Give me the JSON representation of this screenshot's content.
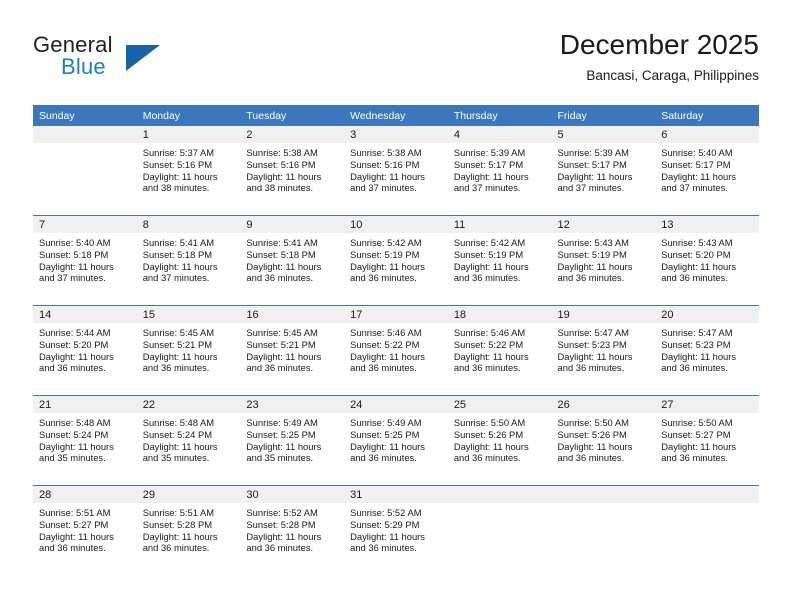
{
  "logo": {
    "word1": "General",
    "word2": "Blue",
    "triangle_color": "#1763a8",
    "blue_color": "#1c7fc3"
  },
  "header": {
    "title": "December 2025",
    "subtitle": "Bancasi, Caraga, Philippines"
  },
  "theme": {
    "header_blue": "#3b77bd",
    "band_gray": "#f0f0f0",
    "text": "#1a1a1a"
  },
  "calendar": {
    "weekday_headers": [
      "Sunday",
      "Monday",
      "Tuesday",
      "Wednesday",
      "Thursday",
      "Friday",
      "Saturday"
    ],
    "weeks": [
      [
        {
          "day": "",
          "empty": true,
          "sunrise": "",
          "sunset": "",
          "daylight1": "",
          "daylight2": ""
        },
        {
          "day": "1",
          "sunrise": "Sunrise: 5:37 AM",
          "sunset": "Sunset: 5:16 PM",
          "daylight1": "Daylight: 11 hours",
          "daylight2": "and 38 minutes."
        },
        {
          "day": "2",
          "sunrise": "Sunrise: 5:38 AM",
          "sunset": "Sunset: 5:16 PM",
          "daylight1": "Daylight: 11 hours",
          "daylight2": "and 38 minutes."
        },
        {
          "day": "3",
          "sunrise": "Sunrise: 5:38 AM",
          "sunset": "Sunset: 5:16 PM",
          "daylight1": "Daylight: 11 hours",
          "daylight2": "and 37 minutes."
        },
        {
          "day": "4",
          "sunrise": "Sunrise: 5:39 AM",
          "sunset": "Sunset: 5:17 PM",
          "daylight1": "Daylight: 11 hours",
          "daylight2": "and 37 minutes."
        },
        {
          "day": "5",
          "sunrise": "Sunrise: 5:39 AM",
          "sunset": "Sunset: 5:17 PM",
          "daylight1": "Daylight: 11 hours",
          "daylight2": "and 37 minutes."
        },
        {
          "day": "6",
          "sunrise": "Sunrise: 5:40 AM",
          "sunset": "Sunset: 5:17 PM",
          "daylight1": "Daylight: 11 hours",
          "daylight2": "and 37 minutes."
        }
      ],
      [
        {
          "day": "7",
          "sunrise": "Sunrise: 5:40 AM",
          "sunset": "Sunset: 5:18 PM",
          "daylight1": "Daylight: 11 hours",
          "daylight2": "and 37 minutes."
        },
        {
          "day": "8",
          "sunrise": "Sunrise: 5:41 AM",
          "sunset": "Sunset: 5:18 PM",
          "daylight1": "Daylight: 11 hours",
          "daylight2": "and 37 minutes."
        },
        {
          "day": "9",
          "sunrise": "Sunrise: 5:41 AM",
          "sunset": "Sunset: 5:18 PM",
          "daylight1": "Daylight: 11 hours",
          "daylight2": "and 36 minutes."
        },
        {
          "day": "10",
          "sunrise": "Sunrise: 5:42 AM",
          "sunset": "Sunset: 5:19 PM",
          "daylight1": "Daylight: 11 hours",
          "daylight2": "and 36 minutes."
        },
        {
          "day": "11",
          "sunrise": "Sunrise: 5:42 AM",
          "sunset": "Sunset: 5:19 PM",
          "daylight1": "Daylight: 11 hours",
          "daylight2": "and 36 minutes."
        },
        {
          "day": "12",
          "sunrise": "Sunrise: 5:43 AM",
          "sunset": "Sunset: 5:19 PM",
          "daylight1": "Daylight: 11 hours",
          "daylight2": "and 36 minutes."
        },
        {
          "day": "13",
          "sunrise": "Sunrise: 5:43 AM",
          "sunset": "Sunset: 5:20 PM",
          "daylight1": "Daylight: 11 hours",
          "daylight2": "and 36 minutes."
        }
      ],
      [
        {
          "day": "14",
          "sunrise": "Sunrise: 5:44 AM",
          "sunset": "Sunset: 5:20 PM",
          "daylight1": "Daylight: 11 hours",
          "daylight2": "and 36 minutes."
        },
        {
          "day": "15",
          "sunrise": "Sunrise: 5:45 AM",
          "sunset": "Sunset: 5:21 PM",
          "daylight1": "Daylight: 11 hours",
          "daylight2": "and 36 minutes."
        },
        {
          "day": "16",
          "sunrise": "Sunrise: 5:45 AM",
          "sunset": "Sunset: 5:21 PM",
          "daylight1": "Daylight: 11 hours",
          "daylight2": "and 36 minutes."
        },
        {
          "day": "17",
          "sunrise": "Sunrise: 5:46 AM",
          "sunset": "Sunset: 5:22 PM",
          "daylight1": "Daylight: 11 hours",
          "daylight2": "and 36 minutes."
        },
        {
          "day": "18",
          "sunrise": "Sunrise: 5:46 AM",
          "sunset": "Sunset: 5:22 PM",
          "daylight1": "Daylight: 11 hours",
          "daylight2": "and 36 minutes."
        },
        {
          "day": "19",
          "sunrise": "Sunrise: 5:47 AM",
          "sunset": "Sunset: 5:23 PM",
          "daylight1": "Daylight: 11 hours",
          "daylight2": "and 36 minutes."
        },
        {
          "day": "20",
          "sunrise": "Sunrise: 5:47 AM",
          "sunset": "Sunset: 5:23 PM",
          "daylight1": "Daylight: 11 hours",
          "daylight2": "and 36 minutes."
        }
      ],
      [
        {
          "day": "21",
          "sunrise": "Sunrise: 5:48 AM",
          "sunset": "Sunset: 5:24 PM",
          "daylight1": "Daylight: 11 hours",
          "daylight2": "and 35 minutes."
        },
        {
          "day": "22",
          "sunrise": "Sunrise: 5:48 AM",
          "sunset": "Sunset: 5:24 PM",
          "daylight1": "Daylight: 11 hours",
          "daylight2": "and 35 minutes."
        },
        {
          "day": "23",
          "sunrise": "Sunrise: 5:49 AM",
          "sunset": "Sunset: 5:25 PM",
          "daylight1": "Daylight: 11 hours",
          "daylight2": "and 35 minutes."
        },
        {
          "day": "24",
          "sunrise": "Sunrise: 5:49 AM",
          "sunset": "Sunset: 5:25 PM",
          "daylight1": "Daylight: 11 hours",
          "daylight2": "and 36 minutes."
        },
        {
          "day": "25",
          "sunrise": "Sunrise: 5:50 AM",
          "sunset": "Sunset: 5:26 PM",
          "daylight1": "Daylight: 11 hours",
          "daylight2": "and 36 minutes."
        },
        {
          "day": "26",
          "sunrise": "Sunrise: 5:50 AM",
          "sunset": "Sunset: 5:26 PM",
          "daylight1": "Daylight: 11 hours",
          "daylight2": "and 36 minutes."
        },
        {
          "day": "27",
          "sunrise": "Sunrise: 5:50 AM",
          "sunset": "Sunset: 5:27 PM",
          "daylight1": "Daylight: 11 hours",
          "daylight2": "and 36 minutes."
        }
      ],
      [
        {
          "day": "28",
          "sunrise": "Sunrise: 5:51 AM",
          "sunset": "Sunset: 5:27 PM",
          "daylight1": "Daylight: 11 hours",
          "daylight2": "and 36 minutes."
        },
        {
          "day": "29",
          "sunrise": "Sunrise: 5:51 AM",
          "sunset": "Sunset: 5:28 PM",
          "daylight1": "Daylight: 11 hours",
          "daylight2": "and 36 minutes."
        },
        {
          "day": "30",
          "sunrise": "Sunrise: 5:52 AM",
          "sunset": "Sunset: 5:28 PM",
          "daylight1": "Daylight: 11 hours",
          "daylight2": "and 36 minutes."
        },
        {
          "day": "31",
          "sunrise": "Sunrise: 5:52 AM",
          "sunset": "Sunset: 5:29 PM",
          "daylight1": "Daylight: 11 hours",
          "daylight2": "and 36 minutes."
        },
        {
          "day": "",
          "empty": true,
          "sunrise": "",
          "sunset": "",
          "daylight1": "",
          "daylight2": ""
        },
        {
          "day": "",
          "empty": true,
          "sunrise": "",
          "sunset": "",
          "daylight1": "",
          "daylight2": ""
        },
        {
          "day": "",
          "empty": true,
          "sunrise": "",
          "sunset": "",
          "daylight1": "",
          "daylight2": ""
        }
      ]
    ]
  }
}
